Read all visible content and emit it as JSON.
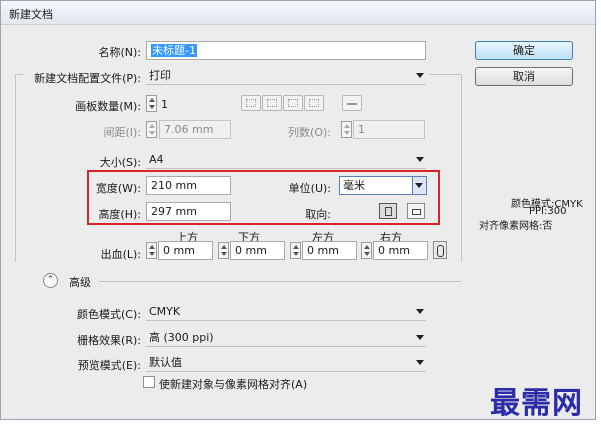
{
  "window": {
    "title": "新建文档"
  },
  "buttons": {
    "ok": "确定",
    "cancel": "取消"
  },
  "name": {
    "label": "名称(N):",
    "value": "未标题-1"
  },
  "profile": {
    "label": "新建文档配置文件(P):",
    "value": "打印"
  },
  "artboards": {
    "label": "画板数量(M):",
    "value": "1"
  },
  "spacing": {
    "label": "间距(I):",
    "value": "7.06 mm"
  },
  "columns": {
    "label": "列数(O):",
    "value": "1"
  },
  "size": {
    "label": "大小(S):",
    "value": "A4"
  },
  "width": {
    "label": "宽度(W):",
    "value": "210 mm"
  },
  "height": {
    "label": "高度(H):",
    "value": "297 mm"
  },
  "units": {
    "label": "单位(U):",
    "value": "毫米"
  },
  "orientation": {
    "label": "取向:",
    "selected": "portrait"
  },
  "bleed": {
    "label": "出血(L):",
    "headers": [
      "上方",
      "下方",
      "左方",
      "右方"
    ],
    "values": [
      "0 mm",
      "0 mm",
      "0 mm",
      "0 mm"
    ]
  },
  "advanced": {
    "label": "高级"
  },
  "color_mode": {
    "label": "颜色模式(C):",
    "value": "CMYK"
  },
  "raster": {
    "label": "栅格效果(R):",
    "value": "高 (300 ppi)"
  },
  "preview": {
    "label": "预览模式(E):",
    "value": "默认值"
  },
  "align_checkbox": {
    "label": "使新建对象与像素网格对齐(A)",
    "checked": false
  },
  "info": {
    "color_mode": "颜色模式:CMYK",
    "ppi": "PPI:300",
    "align": "对齐像素网格:否"
  },
  "watermark": "最需网",
  "colors": {
    "highlight_box": "#d8232a",
    "default_button": "#3c7fb1",
    "watermark": "#2c2ca8"
  }
}
